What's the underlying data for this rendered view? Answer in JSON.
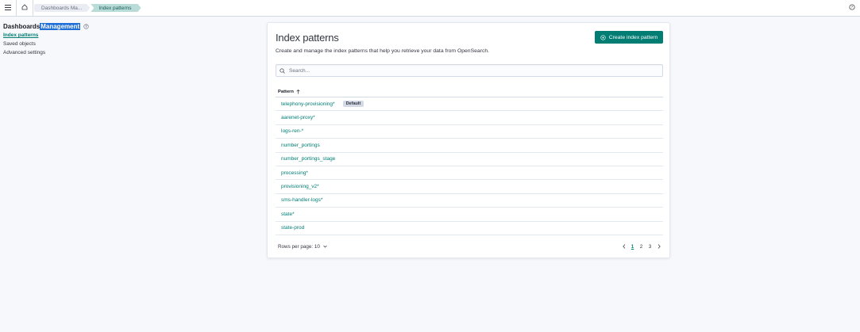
{
  "topbar": {
    "breadcrumbs": [
      "Dashboards Ma...",
      "Index patterns"
    ]
  },
  "sidebar": {
    "title_part1": "Dashboards ",
    "title_part2": "Management",
    "items": [
      {
        "label": "Index patterns",
        "active": true
      },
      {
        "label": "Saved objects",
        "active": false
      },
      {
        "label": "Advanced settings",
        "active": false
      }
    ]
  },
  "panel": {
    "title": "Index patterns",
    "description": "Create and manage the index patterns that help you retrieve your data from OpenSearch.",
    "create_button": "Create index pattern",
    "search_placeholder": "Search...",
    "column_header": "Pattern",
    "rows": [
      {
        "name": "telephony-provisioning*",
        "badge": "Default"
      },
      {
        "name": "aarenet-proxy*"
      },
      {
        "name": "logs-ren-*"
      },
      {
        "name": "number_portings"
      },
      {
        "name": "number_portings_stage"
      },
      {
        "name": "processing*"
      },
      {
        "name": "provisioning_v2*"
      },
      {
        "name": "sms-handler-logs*"
      },
      {
        "name": "state*"
      },
      {
        "name": "state-prod"
      }
    ],
    "rows_per_page": "Rows per page: 10",
    "pages": [
      "1",
      "2",
      "3"
    ],
    "current_page": "1"
  },
  "colors": {
    "accent": "#017d73",
    "highlight": "#1f6fd6",
    "active_crumb": "#b9dcd9"
  }
}
